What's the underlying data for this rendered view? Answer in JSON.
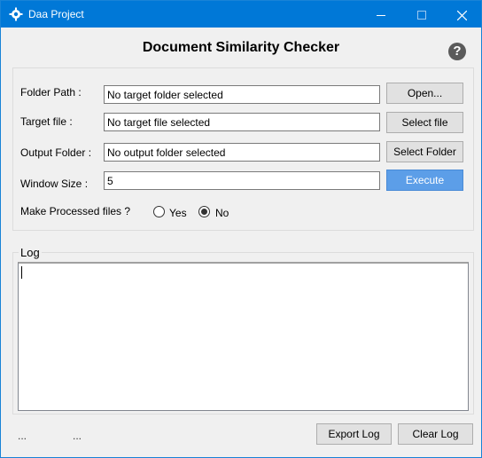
{
  "window": {
    "title": "Daa Project",
    "accent_color": "#0078d7",
    "icon": "gear-icon"
  },
  "header": {
    "title": "Document Similarity Checker",
    "help_glyph": "?"
  },
  "form": {
    "folder_path_label": "Folder Path :",
    "folder_path_value": "No target folder selected",
    "open_button": "Open...",
    "target_file_label": "Target file :",
    "target_file_value": "No target file selected",
    "select_file_button": "Select file",
    "output_folder_label": "Output Folder :",
    "output_folder_value": "No output folder selected",
    "select_folder_button": "Select Folder",
    "window_size_label": "Window Size :",
    "window_size_value": "5",
    "execute_button": "Execute",
    "execute_color": "#5c9ee8",
    "processed_label": "Make Processed files ?",
    "option_yes": "Yes",
    "option_no": "No",
    "selected_option": "No"
  },
  "log": {
    "legend": "Log",
    "content": ""
  },
  "status": {
    "left_1": "...",
    "left_2": "..."
  },
  "footer": {
    "export_button": "Export Log",
    "clear_button": "Clear Log"
  }
}
